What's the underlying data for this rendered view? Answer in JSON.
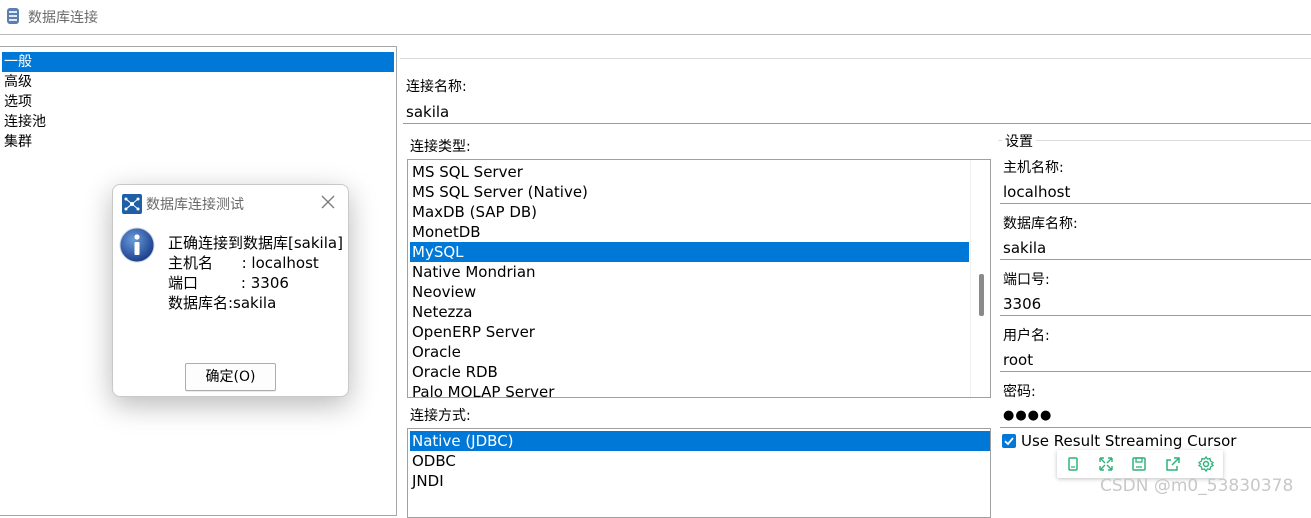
{
  "window": {
    "title": "数据库连接"
  },
  "nav": {
    "items": [
      {
        "label": "一般",
        "selected": true
      },
      {
        "label": "高级",
        "selected": false
      },
      {
        "label": "选项",
        "selected": false
      },
      {
        "label": "连接池",
        "selected": false
      },
      {
        "label": "集群",
        "selected": false
      }
    ]
  },
  "general": {
    "conn_name_label": "连接名称:",
    "conn_name_value": "sakila",
    "conn_type_label": "连接类型:",
    "conn_types": [
      "MS SQL Server",
      "MS SQL Server (Native)",
      "MaxDB (SAP DB)",
      "MonetDB",
      "MySQL",
      "Native Mondrian",
      "Neoview",
      "Netezza",
      "OpenERP Server",
      "Oracle",
      "Oracle RDB",
      "Palo MOLAP Server"
    ],
    "conn_type_selected": "MySQL",
    "access_label": "连接方式:",
    "access_methods": [
      "Native (JDBC)",
      "ODBC",
      "JNDI"
    ],
    "access_selected": "Native (JDBC)"
  },
  "settings": {
    "group_label": "设置",
    "host_label": "主机名称:",
    "host_value": "localhost",
    "db_label": "数据库名称:",
    "db_value": "sakila",
    "port_label": "端口号:",
    "port_value": "3306",
    "user_label": "用户名:",
    "user_value": "root",
    "password_label": "密码:",
    "password_value": "●●●●",
    "streaming_label": "Use Result Streaming Cursor",
    "streaming_checked": true
  },
  "toolbar": {
    "icons": [
      "copy-icon",
      "expand-icon",
      "save-icon",
      "share-icon",
      "gear-icon"
    ]
  },
  "watermark": "CSDN @m0_53830378",
  "dialog": {
    "title": "数据库连接测试",
    "lines": [
      "正确连接到数据库[sakila]",
      "主机名      : localhost",
      "端口         : 3306",
      "数据库名:sakila"
    ],
    "ok_label": "确定(O)"
  },
  "colors": {
    "selection": "#0078d7",
    "accent_green": "#2fb37a"
  }
}
